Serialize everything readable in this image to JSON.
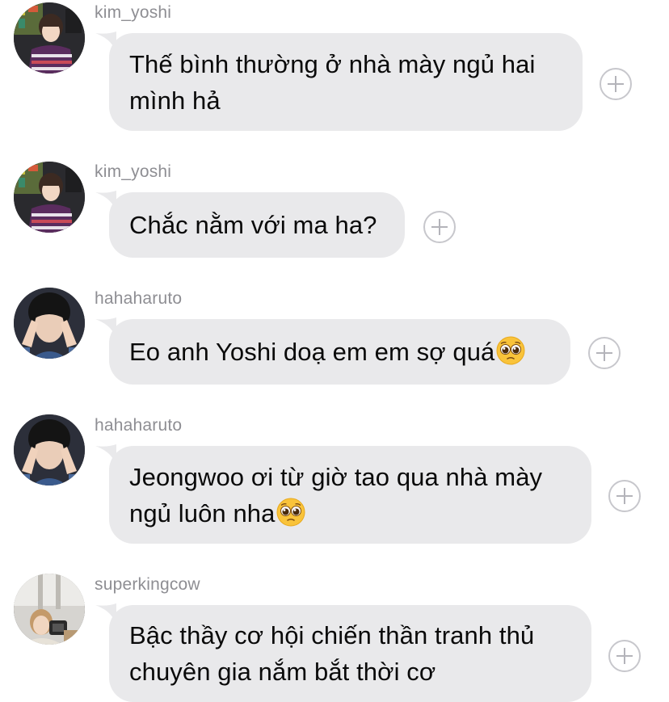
{
  "messages": [
    {
      "username": "kim_yoshi",
      "avatar": "kim-yoshi-avatar",
      "text": "Thế bình thường ở nhà mày ngủ hai mình hả",
      "emoji": null
    },
    {
      "username": "kim_yoshi",
      "avatar": "kim-yoshi-avatar",
      "text": "Chắc nằm với ma ha?",
      "emoji": null
    },
    {
      "username": "hahaharuto",
      "avatar": "hahaharuto-avatar",
      "text": "Eo anh Yoshi doạ em em sợ quá",
      "emoji": "pleading-face"
    },
    {
      "username": "hahaharuto",
      "avatar": "hahaharuto-avatar",
      "text": "Jeongwoo ơi từ giờ tao qua nhà mày ngủ luôn nha",
      "emoji": "pleading-face"
    },
    {
      "username": "superkingcow",
      "avatar": "superkingcow-avatar",
      "text": "Bậc thầy cơ hội chiến thần tranh thủ chuyên gia nắm bắt thời cơ",
      "emoji": null
    }
  ],
  "colors": {
    "bubble": "#e9e9eb",
    "username": "#8e8e93",
    "text": "#0a0a0a",
    "plus": "#c7c7cc"
  },
  "icons": {
    "react": "add-reaction-icon"
  }
}
